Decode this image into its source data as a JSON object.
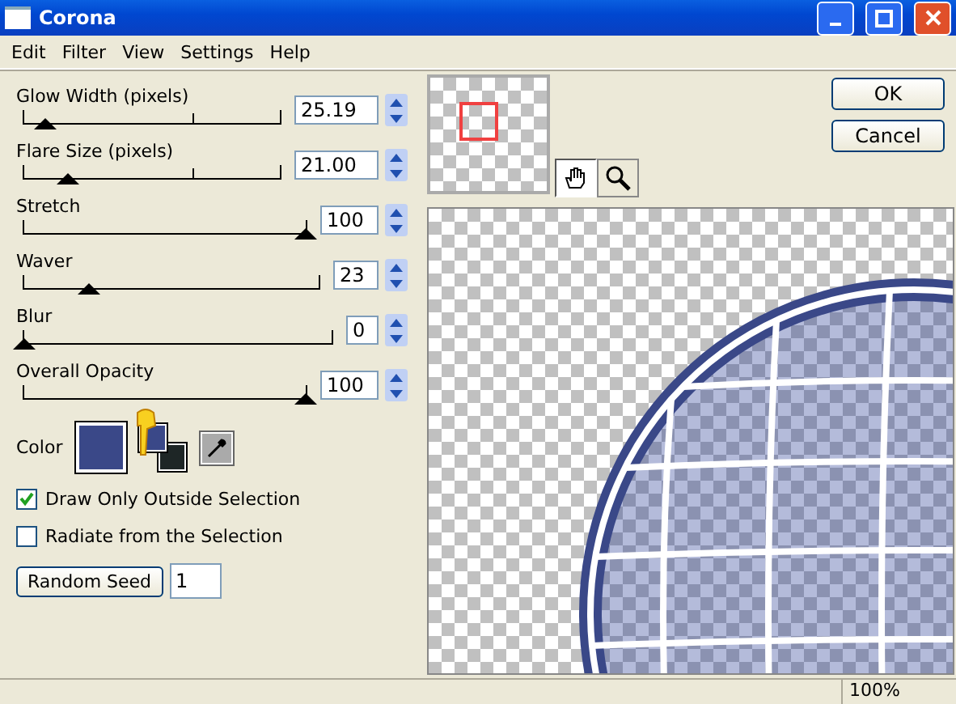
{
  "window": {
    "title": "Corona"
  },
  "menu": [
    "Edit",
    "Filter",
    "View",
    "Settings",
    "Help"
  ],
  "sliders": [
    {
      "label": "Glow Width (pixels)",
      "value": "25.19",
      "level": 0.08,
      "ticks": true
    },
    {
      "label": "Flare Size (pixels)",
      "value": "21.00",
      "level": 0.17,
      "ticks": true
    },
    {
      "label": "Stretch",
      "value": "100",
      "level": 1.0,
      "ticks": false
    },
    {
      "label": "Waver",
      "value": "23",
      "level": 0.22,
      "ticks": false
    },
    {
      "label": "Blur",
      "value": "0",
      "level": 0,
      "ticks": false
    },
    {
      "label": "Overall Opacity",
      "value": "100",
      "level": 1.0,
      "ticks": false
    }
  ],
  "color": {
    "label": "Color",
    "swatches": [
      {
        "kind": "main",
        "color": "#3a4888"
      },
      {
        "kind": "foreground",
        "color": "#3a4888"
      },
      {
        "kind": "background",
        "color": "#1e2626"
      }
    ]
  },
  "checkboxes": [
    {
      "label": "Draw Only Outside Selection",
      "checked": true
    },
    {
      "label": "Radiate from the Selection",
      "checked": false
    }
  ],
  "seed": {
    "button": "Random Seed",
    "value": "1"
  },
  "buttons": [
    "OK",
    "Cancel"
  ],
  "tools": [
    {
      "kind": "hand",
      "selected": true
    },
    {
      "kind": "zoom",
      "selected": false
    }
  ],
  "status_bar": {
    "zoom": "100%"
  }
}
